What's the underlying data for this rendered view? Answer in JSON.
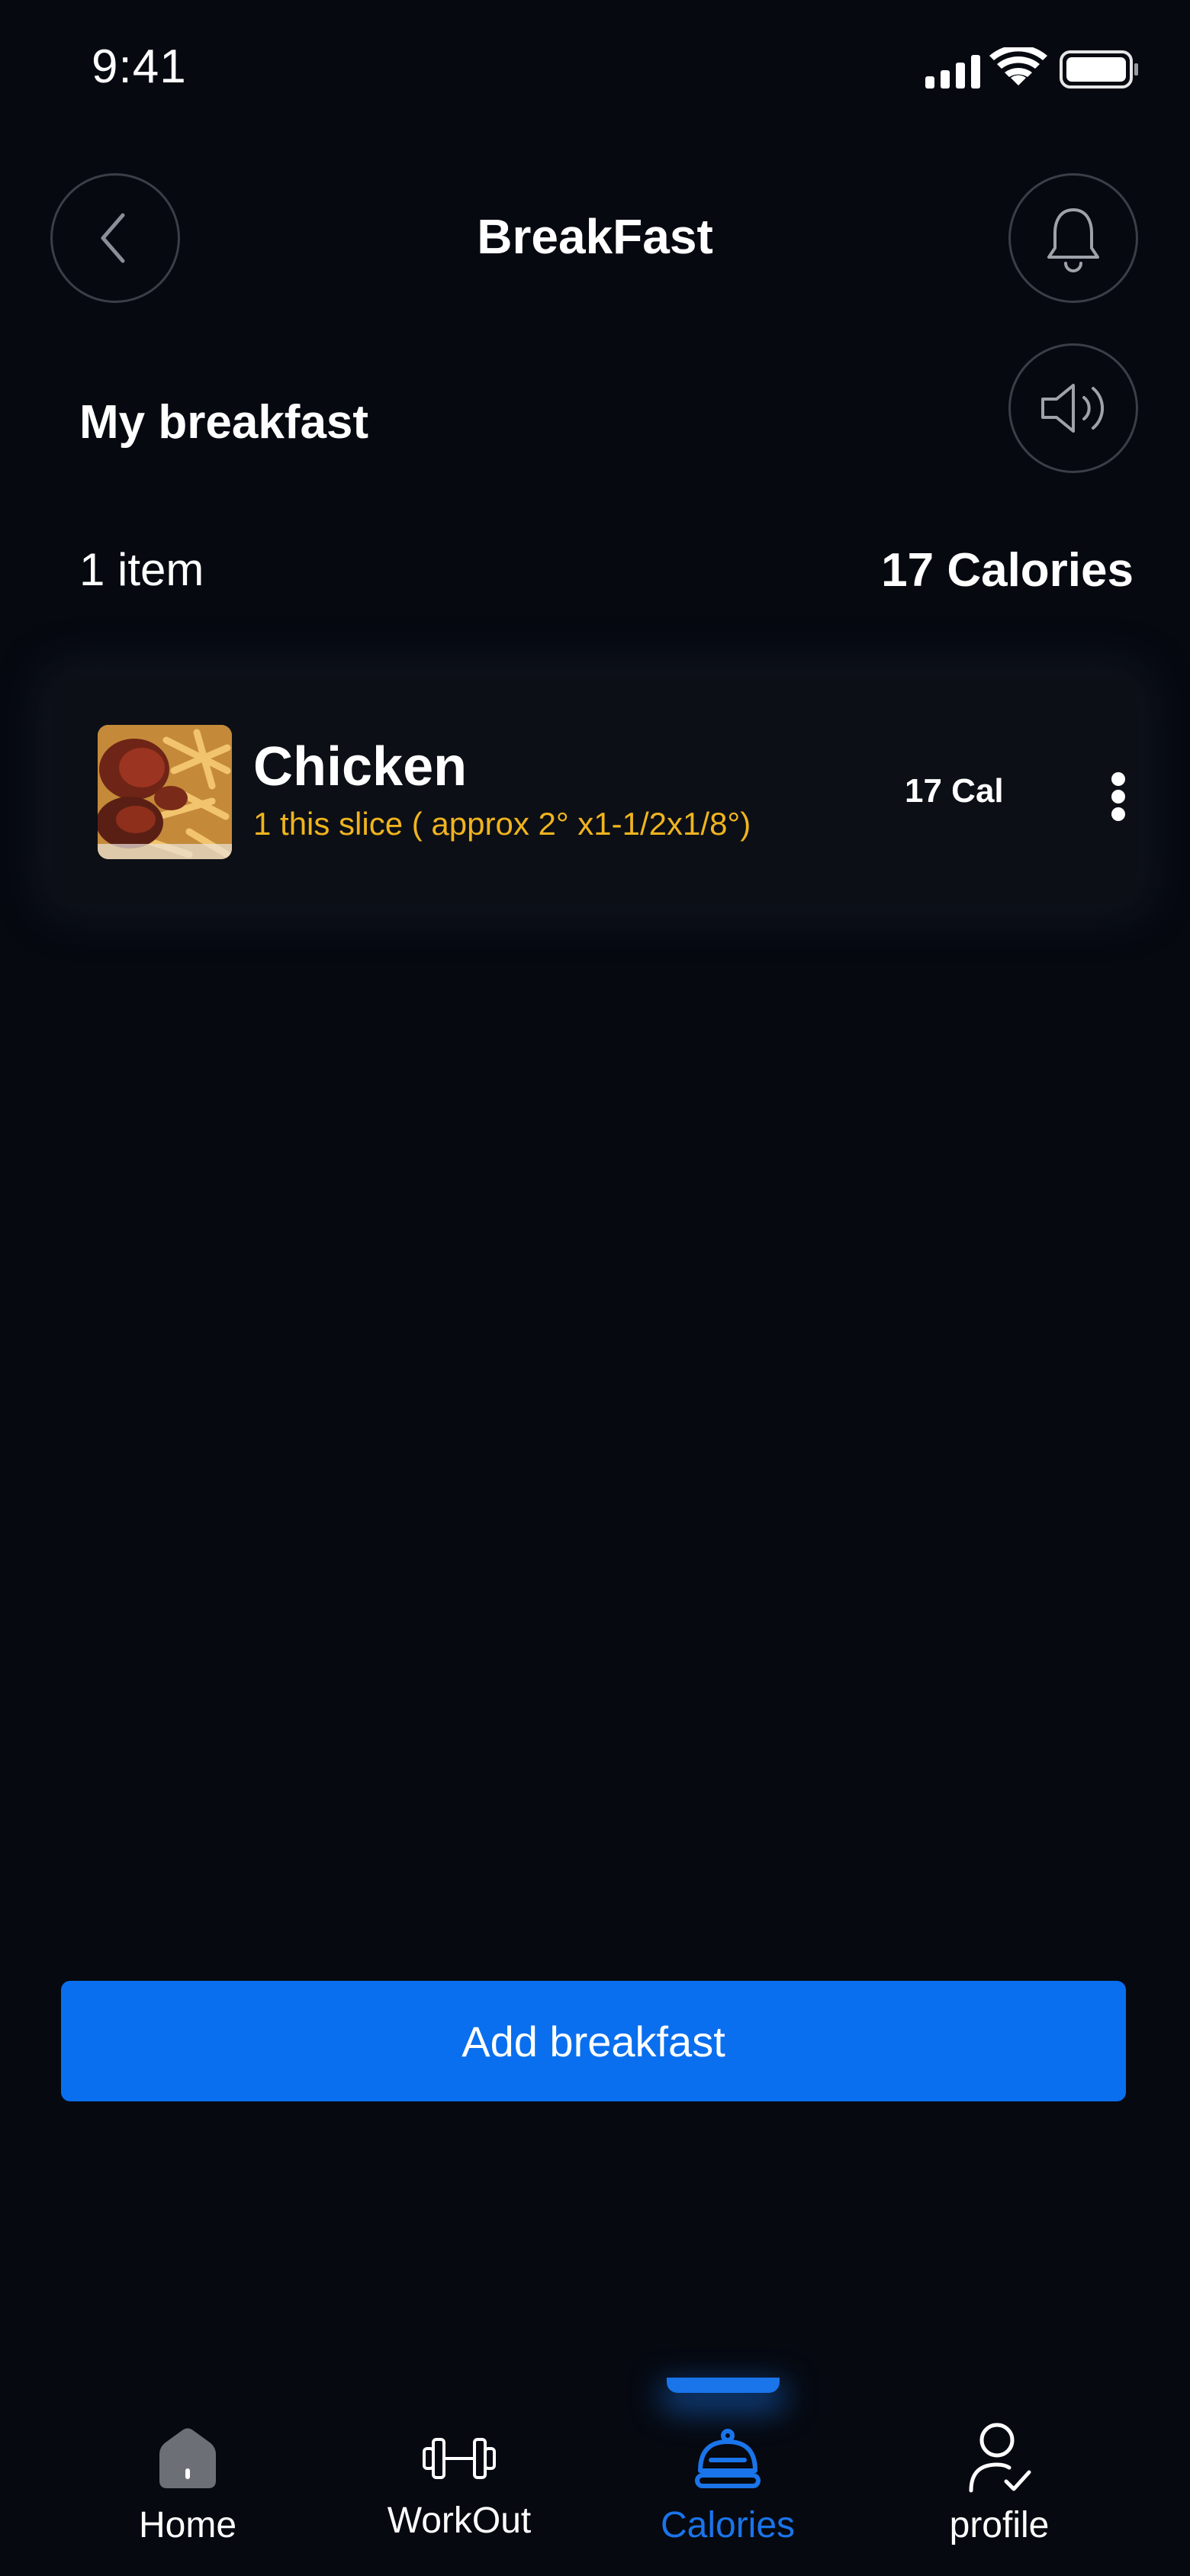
{
  "status_bar": {
    "time": "9:41",
    "icons": [
      "signal-icon",
      "wifi-icon",
      "battery-icon"
    ]
  },
  "header": {
    "title": "BreakFast",
    "back_icon": "chevron-left-icon",
    "bell_icon": "bell-icon",
    "sound_icon": "speaker-icon"
  },
  "section": {
    "title": "My breakfast",
    "items_count": "1 item",
    "total_calories": "17 Calories"
  },
  "food_items": [
    {
      "name": "Chicken",
      "description": "1 this slice ( approx 2° x1-1/2x1/8°)",
      "calories": "17 Cal",
      "image": "chicken-fries-photo"
    }
  ],
  "actions": {
    "add_label": "Add breakfast"
  },
  "bottom_nav": {
    "items": [
      {
        "label": "Home",
        "icon": "home-icon"
      },
      {
        "label": "WorkOut",
        "icon": "dumbbell-icon"
      },
      {
        "label": "Calories",
        "icon": "food-cloche-icon"
      },
      {
        "label": "profile",
        "icon": "user-check-icon"
      }
    ],
    "active": "Calories"
  },
  "colors": {
    "background": "#060910",
    "card": "#0c0f15",
    "accent": "#0a6fee",
    "description": "#f0b41e",
    "border": "#3a3f47"
  }
}
